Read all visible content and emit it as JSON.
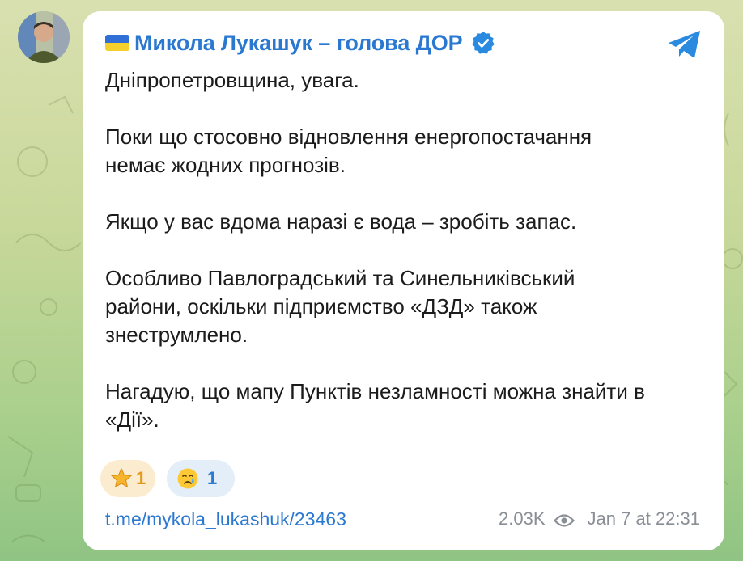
{
  "channel": {
    "flag_emoji": "flag-ukraine-icon",
    "name": "Микола Лукашук – голова ДОР",
    "verified": true,
    "accent_color": "#2a78d0"
  },
  "message": {
    "paragraphs": [
      "Дніпропетровщина, увага.",
      "Поки що стосовно відновлення енергопостачання\nнемає жодних прогнозів.",
      "Якщо у вас вдома наразі є вода – зробіть запас.",
      "Особливо Павлоградський та Синельниківський\nрайони, оскільки підприємство «ДЗД» також\nзнеструмлено.",
      "Нагадую, що мапу Пунктів незламності можна знайти в\n«Дії»."
    ]
  },
  "reactions": [
    {
      "emoji": "star-icon",
      "count": "1"
    },
    {
      "emoji": "crying-face-icon",
      "count": "1"
    }
  ],
  "footer": {
    "link": "t.me/mykola_lukashuk/23463",
    "views": "2.03K",
    "views_icon": "eye-icon",
    "timestamp": "Jan 7 at 22:31"
  },
  "share_icon": "telegram-share-icon"
}
